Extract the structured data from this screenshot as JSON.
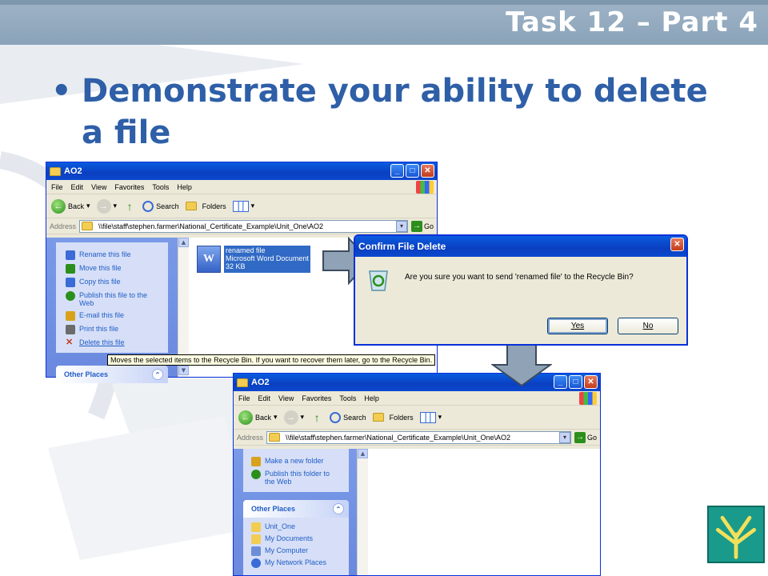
{
  "slide": {
    "title": "Task 12 – Part 4",
    "bullet": "Demonstrate your ability to delete a file"
  },
  "window1": {
    "title": "AO2",
    "menu": [
      "File",
      "Edit",
      "View",
      "Favorites",
      "Tools",
      "Help"
    ],
    "toolbar": {
      "back": "Back",
      "search": "Search",
      "folders": "Folders"
    },
    "address_label": "Address",
    "address": "\\\\file\\staff\\stephen.farmer\\National_Certificate_Example\\Unit_One\\AO2",
    "go": "Go",
    "tasks": [
      {
        "label": "Rename this file",
        "color": "#3a6bd6"
      },
      {
        "label": "Move this file",
        "color": "#2c8f1c"
      },
      {
        "label": "Copy this file",
        "color": "#3a6bd6"
      },
      {
        "label": "Publish this file to the Web",
        "color": "#2c8f1c"
      },
      {
        "label": "E-mail this file",
        "color": "#d8a21c"
      },
      {
        "label": "Print this file",
        "color": "#6b6b6b"
      },
      {
        "label": "Delete this file",
        "color": "#c43c1c"
      }
    ],
    "other_places": "Other Places",
    "file": {
      "name": "renamed file",
      "type": "Microsoft Word Document",
      "size": "32 KB"
    },
    "tooltip": "Moves the selected items to the Recycle Bin. If you want to recover them later, go to the Recycle Bin."
  },
  "dialog": {
    "title": "Confirm File Delete",
    "message": "Are you sure you want to send 'renamed file' to the Recycle Bin?",
    "yes": "Yes",
    "no": "No"
  },
  "window2": {
    "title": "AO2",
    "menu": [
      "File",
      "Edit",
      "View",
      "Favorites",
      "Tools",
      "Help"
    ],
    "toolbar": {
      "back": "Back",
      "search": "Search",
      "folders": "Folders"
    },
    "address_label": "Address",
    "address": "\\\\file\\staff\\stephen.farmer\\National_Certificate_Example\\Unit_One\\AO2",
    "go": "Go",
    "tasks": [
      {
        "label": "Make a new folder",
        "color": "#d8a21c"
      },
      {
        "label": "Publish this folder to the Web",
        "color": "#2c8f1c"
      }
    ],
    "other_places": "Other Places",
    "places": [
      {
        "label": "Unit_One",
        "color": "#f3cd52"
      },
      {
        "label": "My Documents",
        "color": "#f3cd52"
      },
      {
        "label": "My Computer",
        "color": "#6b8fd6"
      },
      {
        "label": "My Network Places",
        "color": "#3a6bd6"
      }
    ]
  }
}
